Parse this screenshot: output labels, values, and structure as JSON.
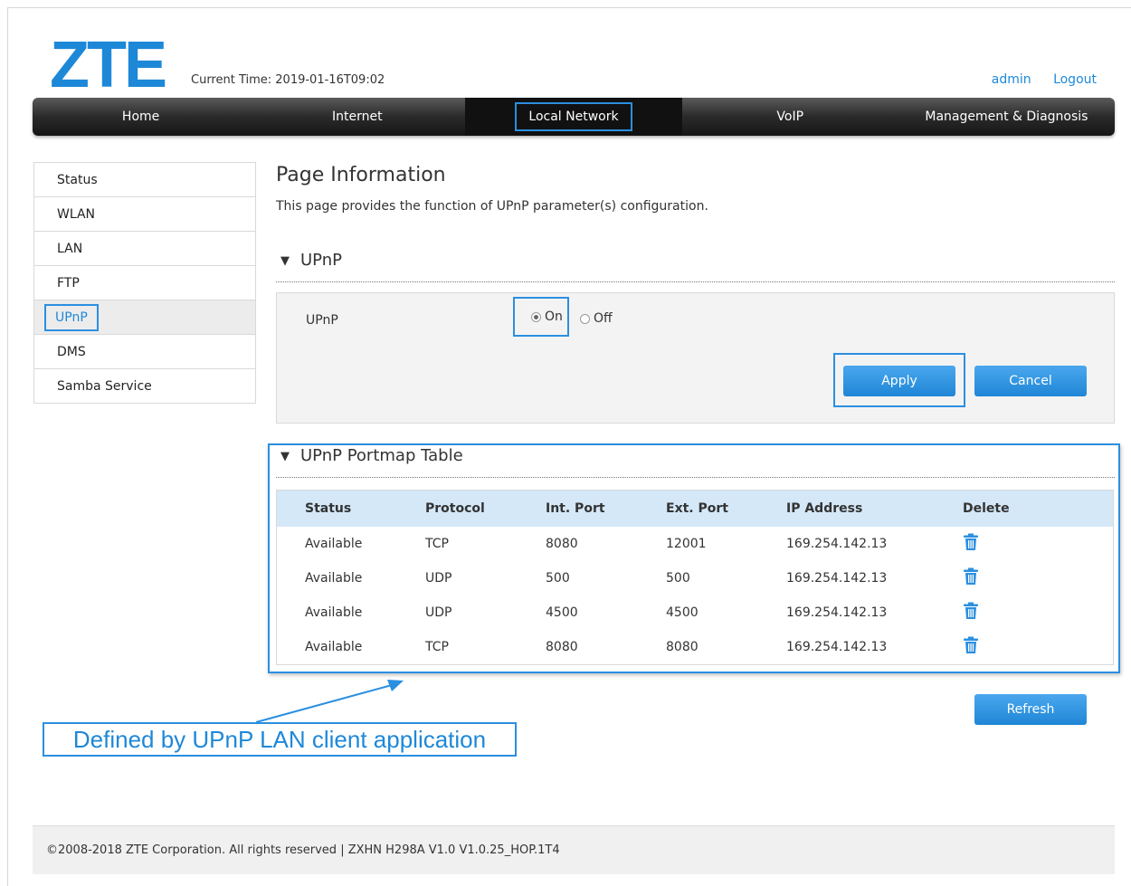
{
  "header": {
    "logo": "ZTE",
    "current_time": "Current Time: 2019-01-16T09:02",
    "user": "admin",
    "logout": "Logout"
  },
  "nav": {
    "items": [
      {
        "label": "Home"
      },
      {
        "label": "Internet"
      },
      {
        "label": "Local Network"
      },
      {
        "label": "VoIP"
      },
      {
        "label": "Management & Diagnosis"
      }
    ],
    "active": "Local Network"
  },
  "sidebar": {
    "items": [
      {
        "label": "Status"
      },
      {
        "label": "WLAN"
      },
      {
        "label": "LAN"
      },
      {
        "label": "FTP"
      },
      {
        "label": "UPnP"
      },
      {
        "label": "DMS"
      },
      {
        "label": "Samba Service"
      }
    ],
    "active": "UPnP"
  },
  "page": {
    "title": "Page Information",
    "description": "This page provides the function of UPnP parameter(s) configuration."
  },
  "upnp": {
    "section_title": "UPnP",
    "field_label": "UPnP",
    "on_label": "On",
    "off_label": "Off",
    "selected": "On",
    "apply_label": "Apply",
    "cancel_label": "Cancel"
  },
  "portmap": {
    "section_title": "UPnP Portmap Table",
    "headers": [
      "Status",
      "Protocol",
      "Int. Port",
      "Ext. Port",
      "IP Address",
      "Delete"
    ],
    "rows": [
      {
        "status": "Available",
        "protocol": "TCP",
        "int_port": "8080",
        "ext_port": "12001",
        "ip": "169.254.142.13"
      },
      {
        "status": "Available",
        "protocol": "UDP",
        "int_port": "500",
        "ext_port": "500",
        "ip": "169.254.142.13"
      },
      {
        "status": "Available",
        "protocol": "UDP",
        "int_port": "4500",
        "ext_port": "4500",
        "ip": "169.254.142.13"
      },
      {
        "status": "Available",
        "protocol": "TCP",
        "int_port": "8080",
        "ext_port": "8080",
        "ip": "169.254.142.13"
      }
    ],
    "delete_icon": "trash-icon",
    "refresh_label": "Refresh"
  },
  "annotation": {
    "text": "Defined by UPnP LAN client application"
  },
  "footer": {
    "text": "©2008-2018 ZTE Corporation. All rights reserved  |   ZXHN H298A V1.0 V1.0.25_HOP.1T4"
  },
  "colors": {
    "brand": "#1e88d8",
    "highlight": "#2b8fe0",
    "button": "#2a8fdc",
    "table_header": "#d4e8f8"
  }
}
